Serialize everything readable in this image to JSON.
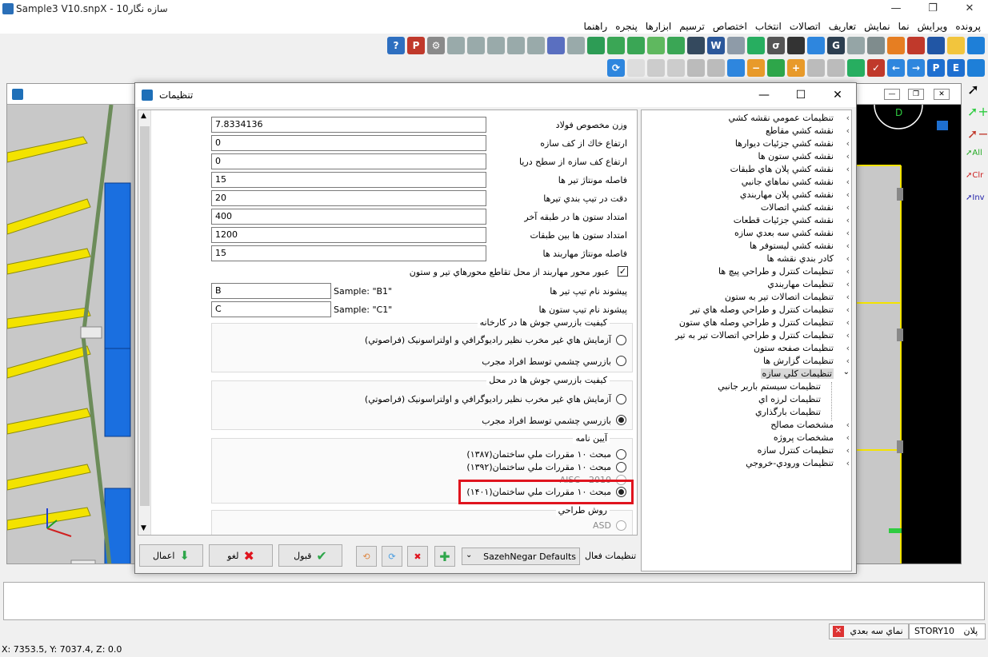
{
  "window": {
    "title": "Sample3 V10.snpX - سازه نگار10"
  },
  "menu": [
    "پرونده",
    "ويرايش",
    "نما",
    "نمايش",
    "تعاريف",
    "اتصالات",
    "انتخاب",
    "اختصاص",
    "ترسيم",
    "ابزارها",
    "پنجره",
    "راهنما"
  ],
  "dialog": {
    "title": "تنظیمات",
    "fields": [
      {
        "label": "وزن مخصوص فولاد",
        "value": "7.8334136"
      },
      {
        "label": "ارتفاع خاك از كف سازه",
        "value": "0"
      },
      {
        "label": "ارتفاع كف سازه از سطح دريا",
        "value": "0"
      },
      {
        "label": "فاصله مونتاژ تير ها",
        "value": "15"
      },
      {
        "label": "دقت در تيپ بندي تيرها",
        "value": "20"
      },
      {
        "label": "امتداد ستون ها در طبقه آخر",
        "value": "400"
      },
      {
        "label": "امتداد ستون ها بين طبقات",
        "value": "1200"
      },
      {
        "label": "فاصله مونتاژ مهاربند ها",
        "value": "15"
      }
    ],
    "checkbox_label": "عبور محور مهاربند از محل تقاطع محورهاي تير و ستون",
    "checkbox_mark": "✓",
    "prefix_beam": {
      "label": "پيشوند نام تيپ تير ها",
      "value": "B",
      "sample": "Sample: \"B1\""
    },
    "prefix_col": {
      "label": "پيشوند نام تيپ ستون ها",
      "value": "C",
      "sample": "Sample: \"C1\""
    },
    "weld_factory": {
      "title": "كيفيت بازرسي جوش ها در كارخانه",
      "opt1": "آزمايش هاي غير مخرب نظير راديوگرافي و اولتراسونيک (فراصوتي)",
      "opt2": "بازرسي چشمي توسط افراد مجرب"
    },
    "weld_site": {
      "title": "كيفيت بازرسي جوش ها در محل",
      "opt1": "آزمايش هاي غير مخرب نظير راديوگرافي و اولتراسونيک (فراصوتي)",
      "opt2": "بازرسي چشمي توسط افراد مجرب"
    },
    "code": {
      "title": "آیین نامه",
      "opt1": "مبحث ۱۰ مقررات ملي ساختمان(۱۳۸۷)",
      "opt2": "مبحث ۱۰ مقررات ملي ساختمان(۱۳۹۲)",
      "opt3": "AISC - 2010",
      "opt4": "مبحث ۱۰ مقررات ملي ساختمان(۱۴۰۱)"
    },
    "design": {
      "title": "روش طراحي",
      "opt1": "ASD"
    },
    "tree": [
      {
        "label": "تنظيمات عمومي نقشه كشي",
        "level": 0
      },
      {
        "label": "نقشه كشي مقاطع",
        "level": 0
      },
      {
        "label": "نقشه كشي جزئيات ديوارها",
        "level": 0
      },
      {
        "label": "نقشه كشي ستون ها",
        "level": 0
      },
      {
        "label": "نقشه كشي پلان هاي طبقات",
        "level": 0
      },
      {
        "label": "نقشه كشي نماهاي جانبي",
        "level": 0
      },
      {
        "label": "نقشه كشي پلان مهاربندي",
        "level": 0
      },
      {
        "label": "نقشه كشي اتصالات",
        "level": 0
      },
      {
        "label": "نقشه كشي جزئيات قطعات",
        "level": 0
      },
      {
        "label": "نقشه كشي سه بعدي سازه",
        "level": 0
      },
      {
        "label": "نقشه كشي ليستوفر ها",
        "level": 0
      },
      {
        "label": "كادر بندي نقشه ها",
        "level": 0
      },
      {
        "label": "تنظيمات كنترل و طراحي پيچ ها",
        "level": 0
      },
      {
        "label": "تنظيمات مهاربندي",
        "level": 0
      },
      {
        "label": "تنظيمات اتصالات تير به ستون",
        "level": 0
      },
      {
        "label": "تنظيمات كنترل و طراحي وصله هاي تير",
        "level": 0
      },
      {
        "label": "تنظيمات كنترل و طراحي وصله هاي ستون",
        "level": 0
      },
      {
        "label": "تنظيمات كنترل و طراحي اتصالات تير به تير",
        "level": 0
      },
      {
        "label": "تنظيمات صفحه ستون",
        "level": 0
      },
      {
        "label": "تنظيمات گزارش ها",
        "level": 0
      },
      {
        "label": "تنظيمات كلي سازه",
        "level": 0,
        "selected": true
      },
      {
        "label": "تنظيمات سيستم باربر جانبي",
        "level": 1
      },
      {
        "label": "تنظيمات لرزه اي",
        "level": 1
      },
      {
        "label": "تنظيمات بارگذاري",
        "level": 1
      },
      {
        "label": "مشخصات مصالح",
        "level": 0
      },
      {
        "label": "مشخصات پروژه",
        "level": 0
      },
      {
        "label": "تنظيمات كنترل سازه",
        "level": 0
      },
      {
        "label": "تنظيمات ورودي-خروجي",
        "level": 0
      }
    ],
    "footer": {
      "apply": "اعمال",
      "cancel": "لغو",
      "ok": "قبول",
      "active_label": "تنظيمات فعال",
      "active_value": "SazehNegar Defaults"
    }
  },
  "status": {
    "coords": "X: 7353.5, Y: 7037.4, Z: 0.0",
    "tab_plan": "پلان",
    "tab_story": "STORY10",
    "tab_3d": "نماي سه بعدي"
  },
  "right_view": {
    "tab": "پلان",
    "tools": [
      "All",
      "Clr",
      "Inv"
    ]
  }
}
